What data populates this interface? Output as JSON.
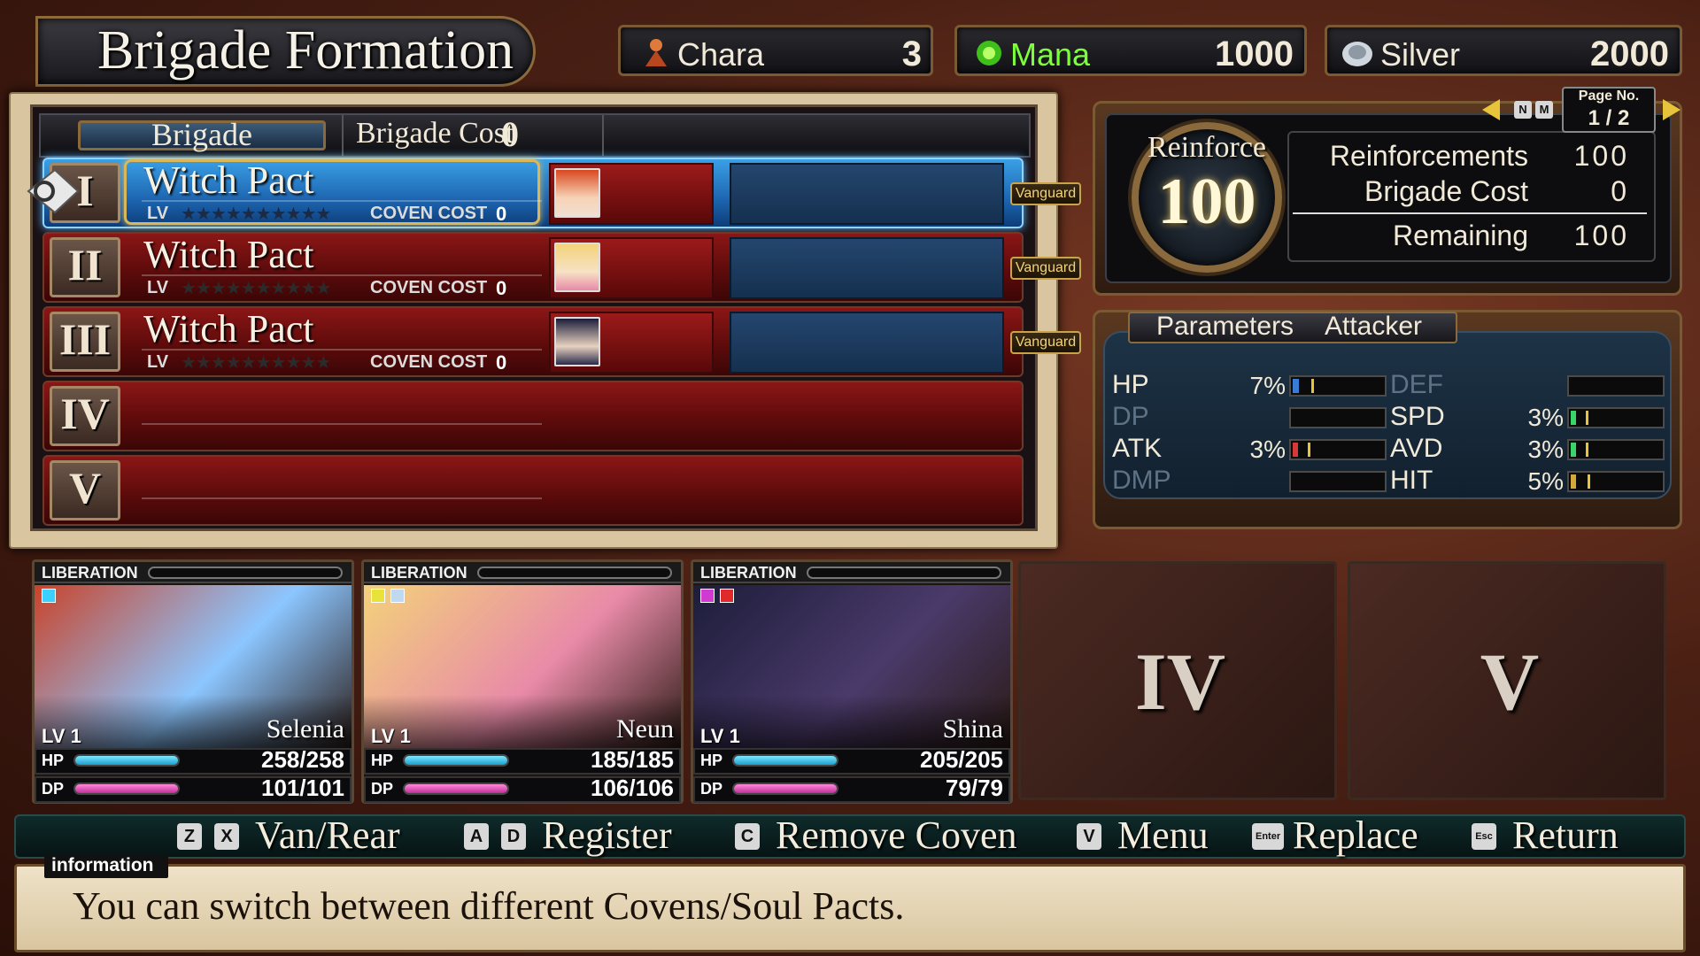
{
  "screen": {
    "title": "Brigade Formation"
  },
  "resources": {
    "chara": {
      "label": "Chara",
      "value": "3",
      "icon": "chara-icon"
    },
    "mana": {
      "label": "Mana",
      "value": "1000",
      "icon": "mana-icon",
      "color": "#7cff3a"
    },
    "silver": {
      "label": "Silver",
      "value": "2000",
      "icon": "silver-coin-icon"
    }
  },
  "brigade": {
    "tab_label": "Brigade",
    "cost_label": "Brigade Cost",
    "cost_value": "0",
    "rows": [
      {
        "numeral": "I",
        "name": "Witch Pact",
        "lv_label": "LV",
        "stars": "★★★★★★★★★★",
        "cost_label": "COVEN COST",
        "cost_value": "0",
        "tag": "Vanguard",
        "selected": true,
        "member_color": "#d9481f"
      },
      {
        "numeral": "II",
        "name": "Witch Pact",
        "lv_label": "LV",
        "stars": "★★★★★★★★★★",
        "cost_label": "COVEN COST",
        "cost_value": "0",
        "tag": "Vanguard",
        "selected": false,
        "member_color": "#f3d27a"
      },
      {
        "numeral": "III",
        "name": "Witch Pact",
        "lv_label": "LV",
        "stars": "★★★★★★★★★★",
        "cost_label": "COVEN COST",
        "cost_value": "0",
        "tag": "Vanguard",
        "selected": false,
        "member_color": "#2a2a4a"
      },
      {
        "numeral": "IV"
      },
      {
        "numeral": "V"
      }
    ]
  },
  "pagination": {
    "label": "Page No.",
    "value": "1 / 2",
    "key_left": "N",
    "key_right": "M"
  },
  "reinforce": {
    "label": "Reinforce",
    "value": "100",
    "stats": [
      {
        "label": "Reinforcements",
        "value": "100"
      },
      {
        "label": "Brigade Cost",
        "value": "0"
      },
      {
        "label": "Remaining",
        "value": "100"
      }
    ]
  },
  "parameters": {
    "title": "Parameters",
    "mode": "Attacker",
    "left": [
      {
        "name": "HP",
        "pct": "7%",
        "level": 0.07,
        "active": true,
        "color": "#3a7bd5"
      },
      {
        "name": "DP",
        "pct": "",
        "level": 0,
        "active": false,
        "color": "#888"
      },
      {
        "name": "ATK",
        "pct": "3%",
        "level": 0.03,
        "active": true,
        "color": "#d53a3a"
      },
      {
        "name": "DMP",
        "pct": "",
        "level": 0,
        "active": false,
        "color": "#888"
      }
    ],
    "right": [
      {
        "name": "DEF",
        "pct": "",
        "level": 0,
        "active": false,
        "color": "#888"
      },
      {
        "name": "SPD",
        "pct": "3%",
        "level": 0.03,
        "active": true,
        "color": "#3ad56a"
      },
      {
        "name": "AVD",
        "pct": "3%",
        "level": 0.03,
        "active": true,
        "color": "#3ad56a"
      },
      {
        "name": "HIT",
        "pct": "5%",
        "level": 0.05,
        "active": true,
        "color": "#d5a83a"
      }
    ]
  },
  "party": [
    {
      "name": "Selenia",
      "lv": "LV 1",
      "hp": "258/258",
      "dp": "101/101",
      "liberation": "LIBERATION",
      "chips": [
        "#3ad0ff"
      ],
      "art_colors": [
        "#c9432a",
        "#8cc6ff"
      ]
    },
    {
      "name": "Neun",
      "lv": "LV 1",
      "hp": "185/185",
      "dp": "106/106",
      "liberation": "LIBERATION",
      "chips": [
        "#e8e23a",
        "#c0d8f0"
      ],
      "art_colors": [
        "#f3d27a",
        "#e88aa8"
      ]
    },
    {
      "name": "Shina",
      "lv": "LV 1",
      "hp": "205/205",
      "dp": "79/79",
      "liberation": "LIBERATION",
      "chips": [
        "#d03ad0",
        "#e02a2a"
      ],
      "art_colors": [
        "#1d1d3a",
        "#4a3a6a"
      ]
    }
  ],
  "empty_slots": [
    "IV",
    "V"
  ],
  "controls": [
    {
      "keys": [
        "Z",
        "X"
      ],
      "label": "Van/Rear"
    },
    {
      "keys": [
        "A",
        "D"
      ],
      "label": "Register"
    },
    {
      "keys": [
        "C"
      ],
      "label": "Remove Coven"
    },
    {
      "keys": [
        "V"
      ],
      "label": "Menu"
    },
    {
      "keys": [
        "Enter"
      ],
      "label": "Replace"
    },
    {
      "keys": [
        "Esc"
      ],
      "label": "Return"
    }
  ],
  "info": {
    "label": "information",
    "text": "You can switch between different Covens/Soul Pacts."
  }
}
